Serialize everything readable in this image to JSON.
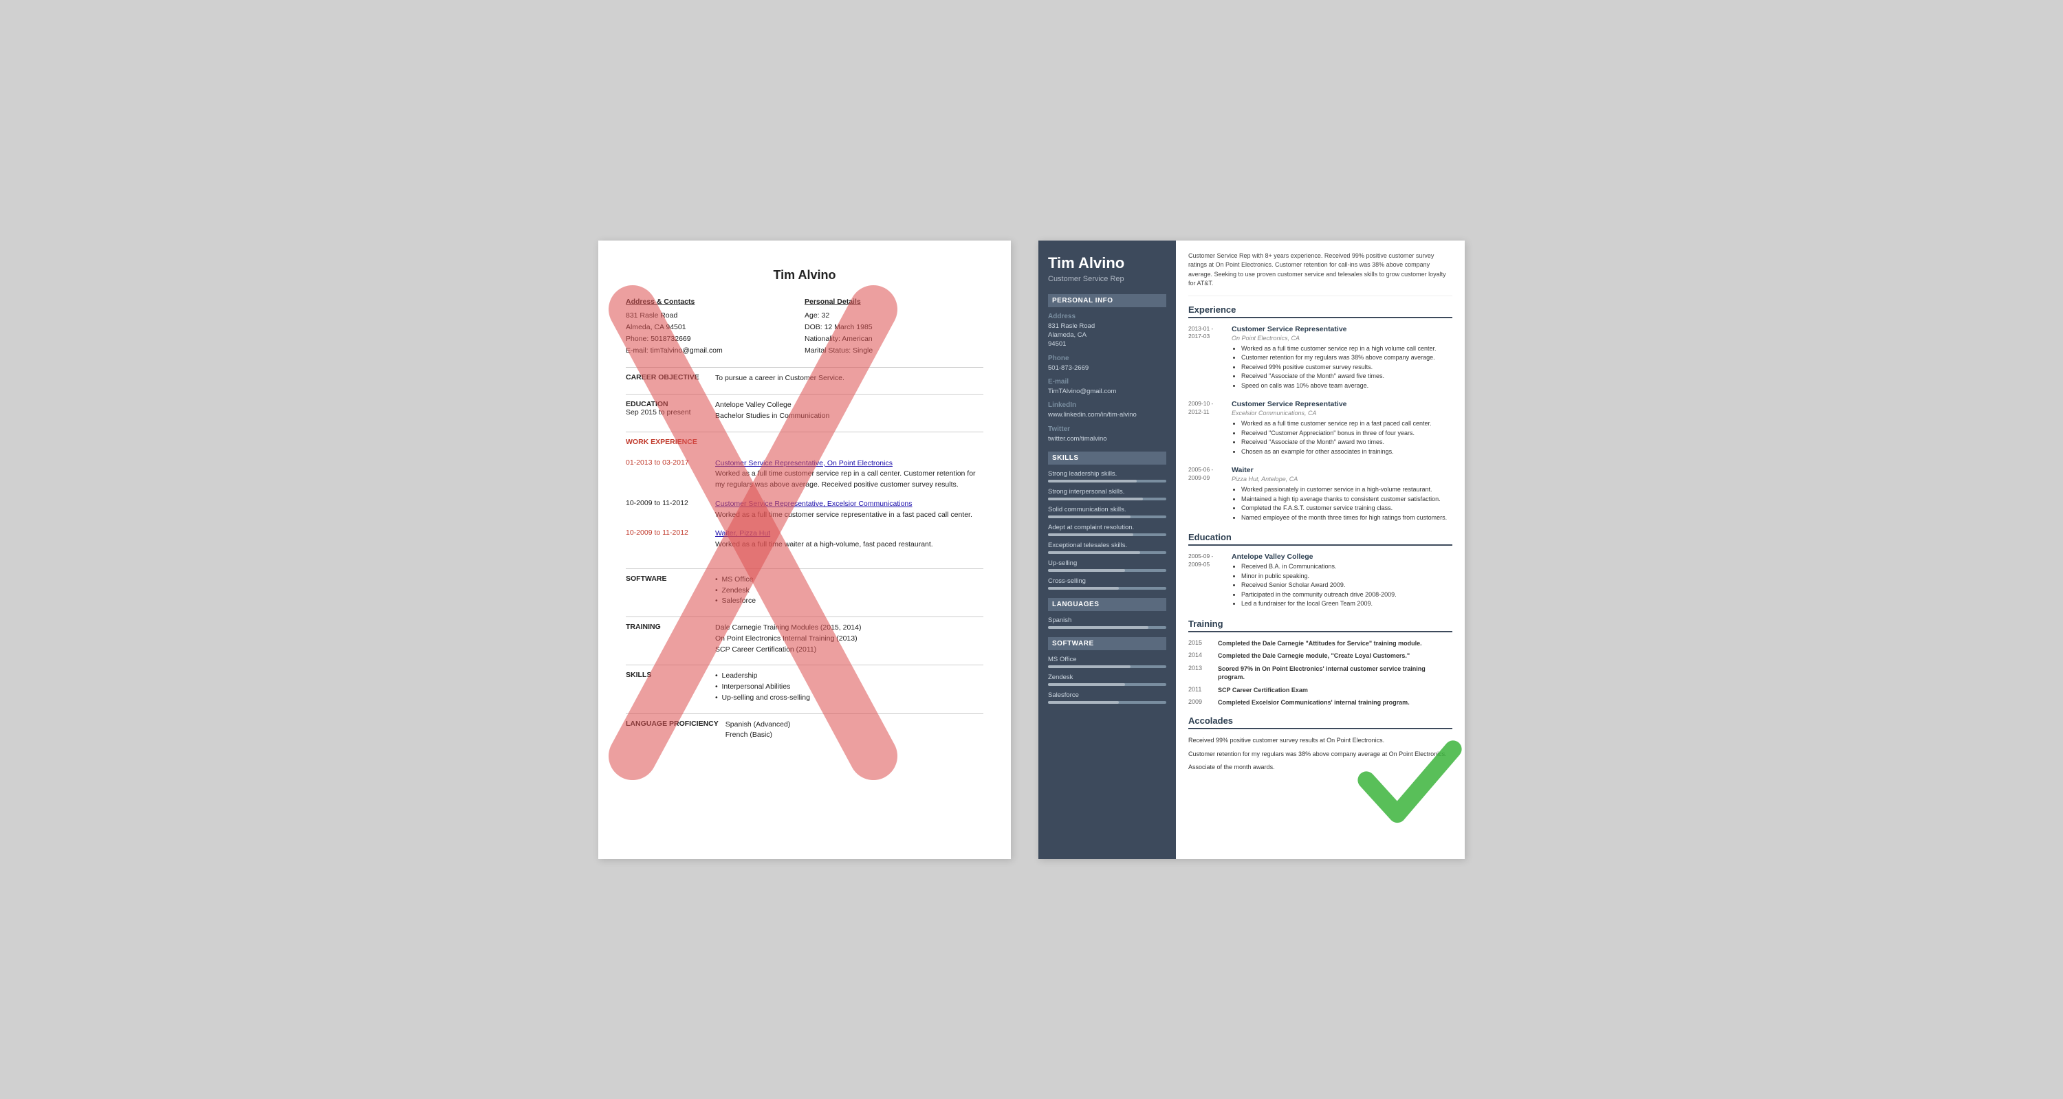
{
  "left_resume": {
    "name": "Tim Alvino",
    "address_label": "Address & Contacts",
    "address_lines": [
      "831 Rasle Road",
      "Almeda, CA 94501",
      "Phone: 5018732669",
      "E-mail: timTalvino@gmail.com"
    ],
    "personal_label": "Personal Details",
    "personal_lines": [
      "Age:  32",
      "DOB:  12 March 1985",
      "Nationality: American",
      "Marital Status: Single"
    ],
    "career_label": "CAREER OBJECTIVE",
    "career_text": "To pursue a career in Customer Service.",
    "education_label": "EDUCATION",
    "education_dates": "Sep 2015 to present",
    "education_lines": [
      "Antelope Valley College",
      "Bachelor Studies in Communication"
    ],
    "work_label": "WORK EXPERIENCE",
    "work_entries": [
      {
        "dates": "01-2013 to 03-2017",
        "title": "Customer Service Representative, On Point Electronics",
        "description": "Worked as a full time customer service rep in a call center. Customer retention for my regulars was above average. Received positive customer survey results."
      },
      {
        "dates": "10-2009 to 11-2012",
        "title": "Customer Service Representative, Excelsior Communications",
        "description": "Worked as a full time customer service representative in a fast paced call center."
      },
      {
        "dates": "10-2009 to 11-2012",
        "title": "Waiter, Pizza Hut",
        "description": "Worked as a full time waiter at a high-volume, fast paced restaurant."
      }
    ],
    "software_label": "SOFTWARE",
    "software_items": [
      "MS Office",
      "Zendesk",
      "Salesforce"
    ],
    "training_label": "TRAINING",
    "training_lines": [
      "Dale Carnegie Training Modules (2015, 2014)",
      "On Point Electronics Internal Training (2013)",
      "SCP Career Certification (2011)"
    ],
    "skills_label": "SKILLS",
    "skills_items": [
      "Leadership",
      "Interpersonal Abilities",
      "Up-selling and cross-selling"
    ],
    "language_label": "LANGUAGE PROFICIENCY",
    "language_lines": [
      "Spanish (Advanced)",
      "French (Basic)"
    ]
  },
  "right_resume": {
    "name": "Tim Alvino",
    "title": "Customer Service Rep",
    "intro": "Customer Service Rep with 8+ years experience. Received 99% positive customer survey ratings at On Point Electronics. Customer retention for call-ins was 38% above company average. Seeking to use proven customer service and telesales skills to grow customer loyalty for AT&T.",
    "personal_info_section": "Personal Info",
    "address_label": "Address",
    "address_lines": [
      "831 Rasle Road",
      "Alameda, CA",
      "94501"
    ],
    "phone_label": "Phone",
    "phone_value": "501-873-2669",
    "email_label": "E-mail",
    "email_value": "TimTAlvino@gmail.com",
    "linkedin_label": "LinkedIn",
    "linkedin_value": "www.linkedin.com/in/tim-alvino",
    "twitter_label": "Twitter",
    "twitter_value": "twitter.com/timalvino",
    "skills_section": "Skills",
    "skills": [
      {
        "label": "Strong leadership skills.",
        "pct": 75
      },
      {
        "label": "Strong interpersonal skills.",
        "pct": 80
      },
      {
        "label": "Solid communication skills.",
        "pct": 70
      },
      {
        "label": "Adept at complaint resolution.",
        "pct": 72
      },
      {
        "label": "Exceptional telesales skills.",
        "pct": 78
      },
      {
        "label": "Up-selling",
        "pct": 65
      },
      {
        "label": "Cross-selling",
        "pct": 60
      }
    ],
    "languages_section": "Languages",
    "languages": [
      {
        "label": "Spanish",
        "pct": 85
      }
    ],
    "software_section": "Software",
    "software": [
      {
        "label": "MS Office",
        "pct": 70
      },
      {
        "label": "Zendesk",
        "pct": 65
      },
      {
        "label": "Salesforce",
        "pct": 60
      }
    ],
    "experience_section": "Experience",
    "experiences": [
      {
        "dates": "2013-01 -\n2017-03",
        "job_title": "Customer Service Representative",
        "company": "On Point Electronics, CA",
        "bullets": [
          "Worked as a full time customer service rep in a high volume call center.",
          "Customer retention for my regulars was 38% above company average.",
          "Received 99% positive customer survey results.",
          "Received \"Associate of the Month\" award five times.",
          "Speed on calls was 10% above team average."
        ]
      },
      {
        "dates": "2009-10 -\n2012-11",
        "job_title": "Customer Service Representative",
        "company": "Excelsior Communications, CA",
        "bullets": [
          "Worked as a full time customer service rep in a fast paced call center.",
          "Received \"Customer Appreciation\" bonus in three of four years.",
          "Received \"Associate of the Month\" award two times.",
          "Chosen as an example for other associates in trainings."
        ]
      },
      {
        "dates": "2005-06 -\n2009-09",
        "job_title": "Waiter",
        "company": "Pizza Hut, Antelope, CA",
        "bullets": [
          "Worked passionately in customer service in a high-volume restaurant.",
          "Maintained a high tip average thanks to consistent customer satisfaction.",
          "Completed the F.A.S.T. customer service training class.",
          "Named employee of the month three times for high ratings from customers."
        ]
      }
    ],
    "education_section": "Education",
    "education": [
      {
        "dates": "2005-09 -\n2009-05",
        "school": "Antelope Valley College",
        "bullets": [
          "Received B.A. in Communications.",
          "Minor in public speaking.",
          "Received Senior Scholar Award 2009.",
          "Participated in the community outreach drive 2008-2009.",
          "Led a fundraiser for the local Green Team 2009."
        ]
      }
    ],
    "training_section": "Training",
    "training": [
      {
        "year": "2015",
        "text": "Completed the Dale Carnegie \"Attitudes for Service\" training module."
      },
      {
        "year": "2014",
        "text": "Completed the Dale Carnegie module, \"Create Loyal Customers.\""
      },
      {
        "year": "2013",
        "text": "Scored 97% in On Point Electronics' internal customer service training program."
      },
      {
        "year": "2011",
        "text": "SCP Career Certification Exam"
      },
      {
        "year": "2009",
        "text": "Completed Excelsior Communications' internal training program."
      }
    ],
    "accolades_section": "Accolades",
    "accolades": [
      "Received 99% positive customer survey results at On Point Electronics.",
      "Customer retention for my regulars was 38% above company average at On Point Electronics.",
      "Associate of the month awards."
    ]
  }
}
